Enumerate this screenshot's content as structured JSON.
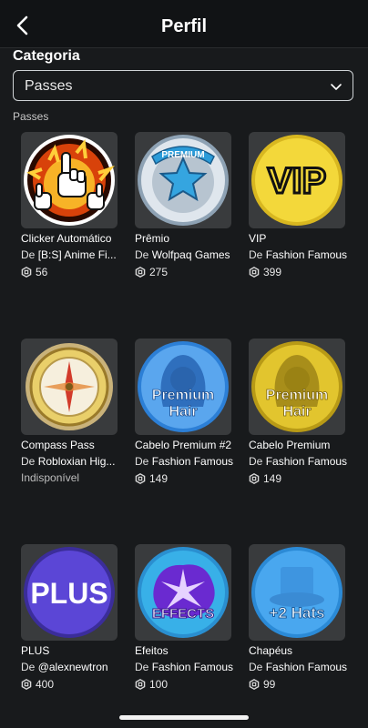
{
  "header": {
    "title": "Perfil",
    "back_icon": "chevron-left-icon"
  },
  "category": {
    "label": "Categoria",
    "selected": "Passes"
  },
  "section_title": "Passes",
  "items": [
    {
      "name": "Clicker Automático",
      "creator_prefix": "De",
      "creator": "[B:S] Anime Fi...",
      "price": "56",
      "icon": "auto-clicker-hands-icon"
    },
    {
      "name": "Prêmio",
      "creator_prefix": "De",
      "creator": "Wolfpaq Games",
      "price": "275",
      "icon": "premium-star-badge-icon"
    },
    {
      "name": "VIP",
      "creator_prefix": "De",
      "creator": "Fashion Famous",
      "price": "399",
      "icon": "vip-badge-icon"
    },
    {
      "name": "Compass Pass",
      "creator_prefix": "De",
      "creator": "Robloxian Hig...",
      "status": "Indisponível",
      "icon": "compass-icon"
    },
    {
      "name": "Cabelo Premium #2",
      "creator_prefix": "De",
      "creator": "Fashion Famous",
      "price": "149",
      "icon": "premium-hair-blue-icon",
      "badge_text": "Premium Hair"
    },
    {
      "name": "Cabelo Premium",
      "creator_prefix": "De",
      "creator": "Fashion Famous",
      "price": "149",
      "icon": "premium-hair-gold-icon",
      "badge_text": "Premium Hair"
    },
    {
      "name": "PLUS",
      "creator_prefix": "De",
      "creator": "@alexnewtron",
      "price": "400",
      "icon": "plus-badge-icon",
      "badge_text": "PLUS"
    },
    {
      "name": "Efeitos",
      "creator_prefix": "De",
      "creator": "Fashion Famous",
      "price": "100",
      "icon": "effects-badge-icon",
      "badge_text": "EFFECTS"
    },
    {
      "name": "Chapéus",
      "creator_prefix": "De",
      "creator": "Fashion Famous",
      "price": "99",
      "icon": "hats-badge-icon",
      "badge_text": "+2 Hats"
    }
  ],
  "badges": {
    "premium_ribbon": "PREMIUM",
    "vip": "VIP"
  }
}
